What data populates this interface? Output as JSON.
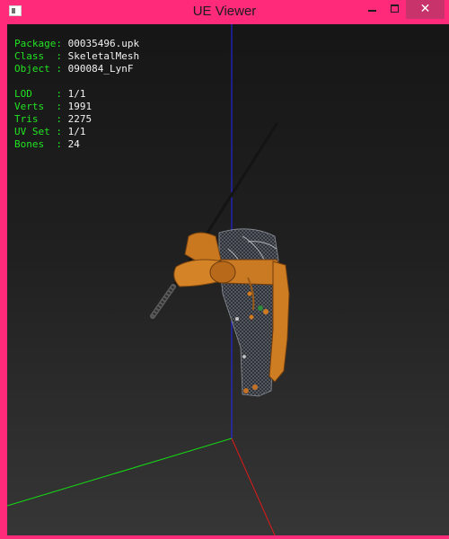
{
  "window": {
    "title": "UE Viewer",
    "close_glyph": "✕",
    "colors": {
      "frame": "#ff2a7a",
      "close": "#c7336a"
    }
  },
  "info": {
    "package": {
      "label": "Package",
      "value": "00035496.upk"
    },
    "class": {
      "label": "Class  ",
      "value": "SkeletalMesh"
    },
    "object": {
      "label": "Object ",
      "value": "090084_LynF"
    },
    "lod": {
      "label": "LOD    ",
      "value": "1/1"
    },
    "verts": {
      "label": "Verts  ",
      "value": "1991"
    },
    "tris": {
      "label": "Tris   ",
      "value": "2275"
    },
    "uvset": {
      "label": "UV Set ",
      "value": "1/1"
    },
    "bones": {
      "label": "Bones  ",
      "value": "24"
    },
    "colors": {
      "label": "#22e322",
      "value": "#f2f2f2"
    }
  },
  "scene": {
    "axis_colors": {
      "x": "#e01919",
      "y": "#14e014",
      "z": "#2222ff"
    }
  }
}
